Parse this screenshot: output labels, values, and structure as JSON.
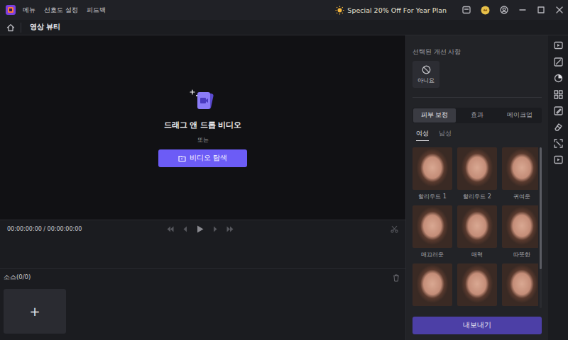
{
  "titlebar": {
    "menu": [
      {
        "label": "메뉴"
      },
      {
        "label": "선호도 설정"
      },
      {
        "label": "피드백"
      }
    ],
    "promo": "Special 20% Off For Year Plan"
  },
  "tabbar": {
    "tabs": [
      {
        "label": "영상 뷰티",
        "selected": true
      }
    ]
  },
  "preview": {
    "drop_title": "드래그 앤 드롭 비디오",
    "or": "또는",
    "browse_button": "비디오 탐색"
  },
  "player": {
    "time": "00:00:00:00 / 00:00:00:00"
  },
  "source": {
    "label": "소스(0/0)",
    "add": "+"
  },
  "panel": {
    "selected_title": "선택된 개선 사항",
    "selected_item": {
      "label": "아니요"
    },
    "tabs": [
      {
        "label": "피부 보정",
        "selected": true
      },
      {
        "label": "효과",
        "selected": false
      },
      {
        "label": "메이크업",
        "selected": false
      }
    ],
    "subtabs": [
      {
        "label": "여성",
        "selected": true
      },
      {
        "label": "남성",
        "selected": false
      }
    ],
    "presets": [
      {
        "label": "할리우드 1"
      },
      {
        "label": "할리우드 2"
      },
      {
        "label": "귀여운"
      },
      {
        "label": "매끄러운"
      },
      {
        "label": "매력"
      },
      {
        "label": "따뜻한"
      },
      {},
      {},
      {}
    ],
    "export_button": "내보내기"
  }
}
